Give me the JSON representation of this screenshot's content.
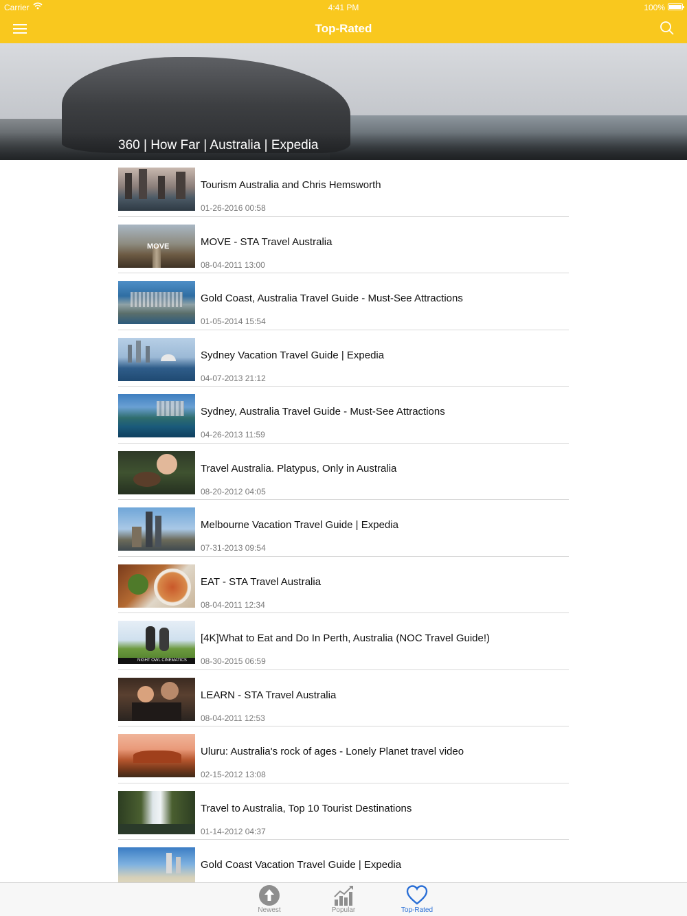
{
  "status_bar": {
    "carrier": "Carrier",
    "time": "4:41 PM",
    "battery": "100%"
  },
  "nav": {
    "title": "Top-Rated"
  },
  "hero": {
    "title": "360 | How Far | Australia | Expedia"
  },
  "videos": [
    {
      "title": "Tourism Australia and Chris Hemsworth",
      "date": "01-26-2016 00:58"
    },
    {
      "title": "MOVE - STA Travel Australia",
      "date": "08-04-2011 13:00",
      "thumb_text": "MOVE"
    },
    {
      "title": "Gold Coast, Australia Travel Guide - Must-See Attractions",
      "date": "01-05-2014 15:54"
    },
    {
      "title": "Sydney Vacation Travel Guide | Expedia",
      "date": "04-07-2013 21:12"
    },
    {
      "title": "Sydney, Australia Travel Guide - Must-See Attractions",
      "date": "04-26-2013 11:59"
    },
    {
      "title": "Travel Australia. Platypus, Only in Australia",
      "date": "08-20-2012 04:05"
    },
    {
      "title": "Melbourne Vacation Travel Guide | Expedia",
      "date": "07-31-2013 09:54"
    },
    {
      "title": "EAT - STA Travel Australia",
      "date": "08-04-2011 12:34"
    },
    {
      "title": "[4K]What to Eat and Do In Perth, Australia (NOC Travel Guide!)",
      "date": "08-30-2015 06:59",
      "thumb_text": "NIGHT OWL CINEMATICS"
    },
    {
      "title": "LEARN - STA Travel Australia",
      "date": "08-04-2011 12:53"
    },
    {
      "title": "Uluru: Australia's rock of ages - Lonely Planet travel video",
      "date": "02-15-2012 13:08"
    },
    {
      "title": "Travel to Australia, Top 10 Tourist Destinations",
      "date": "01-14-2012 04:37"
    },
    {
      "title": "Gold Coast Vacation Travel Guide | Expedia",
      "date": ""
    }
  ],
  "tabs": [
    {
      "label": "Newest",
      "icon": "arrow-up-circle-icon"
    },
    {
      "label": "Popular",
      "icon": "bar-chart-icon"
    },
    {
      "label": "Top-Rated",
      "icon": "heart-icon",
      "active": true
    }
  ],
  "colors": {
    "accent": "#F9C81E",
    "active_tab": "#2a6fd6",
    "inactive_tab": "#8e8e8e"
  }
}
